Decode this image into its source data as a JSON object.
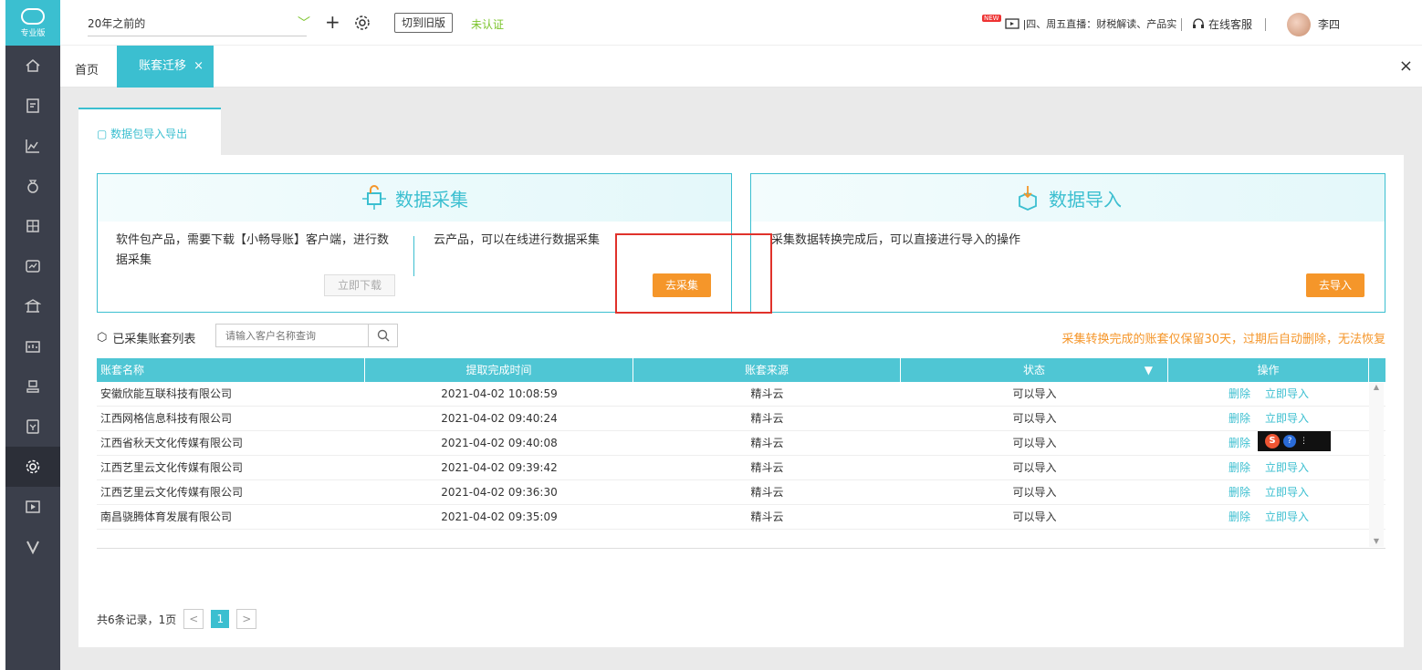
{
  "sidebar": {
    "logo_label": "专业版",
    "items": [
      "home-icon",
      "voucher-icon",
      "report-icon",
      "money-bag-icon",
      "ledger-icon",
      "assets-icon",
      "building-icon",
      "bank-icon",
      "stamp-icon",
      "invoice-icon",
      "settings-icon",
      "media-icon",
      "brand-v-icon"
    ]
  },
  "topbar": {
    "year_select": "20年之前的",
    "old_version_button": "切到旧版",
    "cert_status": "未认证",
    "live_new_badge": "NEW",
    "live_text": "|四、周五直播：财税解读、产品实",
    "service_label": "在线客服",
    "user_name": "李四"
  },
  "tabs": {
    "home": "首页",
    "active": "账套迁移",
    "active_close": "×",
    "close_all": "×"
  },
  "subtab": {
    "label": "数据包导入导出"
  },
  "collect_card": {
    "title": "数据采集",
    "left_text": "软件包产品，需要下载【小畅导账】客户端，进行数据采集",
    "download_button": "立即下载",
    "right_text": "云产品，可以在线进行数据采集",
    "collect_button": "去采集"
  },
  "import_card": {
    "title": "数据导入",
    "text": "采集数据转换完成后，可以直接进行导入的操作",
    "import_button": "去导入"
  },
  "list": {
    "title": "已采集账套列表",
    "search_placeholder": "请输入客户名称查询",
    "retention_notice": "采集转换完成的账套仅保留30天，过期后自动删除，无法恢复"
  },
  "table": {
    "columns": [
      "账套名称",
      "提取完成时间",
      "账套来源",
      "状态",
      "操作"
    ],
    "actions": {
      "delete": "删除",
      "import": "立即导入"
    },
    "rows": [
      {
        "name": "安徽欣能互联科技有限公司",
        "time": "2021-04-02 10:08:59",
        "source": "精斗云",
        "status": "可以导入"
      },
      {
        "name": "江西网格信息科技有限公司",
        "time": "2021-04-02 09:40:24",
        "source": "精斗云",
        "status": "可以导入"
      },
      {
        "name": "江西省秋天文化传媒有限公司",
        "time": "2021-04-02 09:40:08",
        "source": "精斗云",
        "status": "可以导入"
      },
      {
        "name": "江西艺里云文化传媒有限公司",
        "time": "2021-04-02 09:39:42",
        "source": "精斗云",
        "status": "可以导入"
      },
      {
        "name": "江西艺里云文化传媒有限公司",
        "time": "2021-04-02 09:36:30",
        "source": "精斗云",
        "status": "可以导入"
      },
      {
        "name": "南昌骁腾体育发展有限公司",
        "time": "2021-04-02 09:35:09",
        "source": "精斗云",
        "status": "可以导入"
      }
    ]
  },
  "pager": {
    "summary": "共6条记录，1页",
    "prev": "<",
    "current": "1",
    "next": ">"
  },
  "colors": {
    "accent": "#3bbfd0",
    "orange": "#f5962a",
    "sidebar": "#3b3f4b",
    "highlight_red": "#e0322b"
  }
}
